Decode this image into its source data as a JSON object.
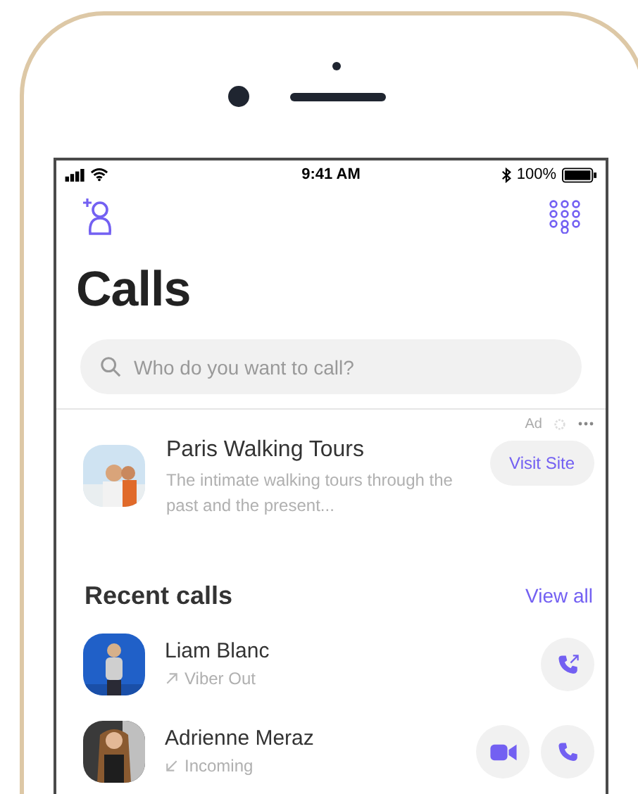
{
  "status_bar": {
    "time": "9:41 AM",
    "battery": "100%"
  },
  "title": "Calls",
  "search": {
    "placeholder": "Who do you want to call?"
  },
  "ad": {
    "label": "Ad",
    "title": "Paris Walking Tours",
    "description": "The intimate walking tours through the past and the present...",
    "button": "Visit Site"
  },
  "recent": {
    "heading": "Recent calls",
    "link": "View all",
    "calls": [
      {
        "name": "Liam Blanc",
        "kind": "outgoing",
        "detail": "Viber Out",
        "actions": [
          {
            "kind": "call-out"
          }
        ]
      },
      {
        "name": "Adrienne Meraz",
        "kind": "incoming",
        "detail": "Incoming",
        "actions": [
          {
            "kind": "video"
          },
          {
            "kind": "call"
          }
        ]
      }
    ]
  }
}
